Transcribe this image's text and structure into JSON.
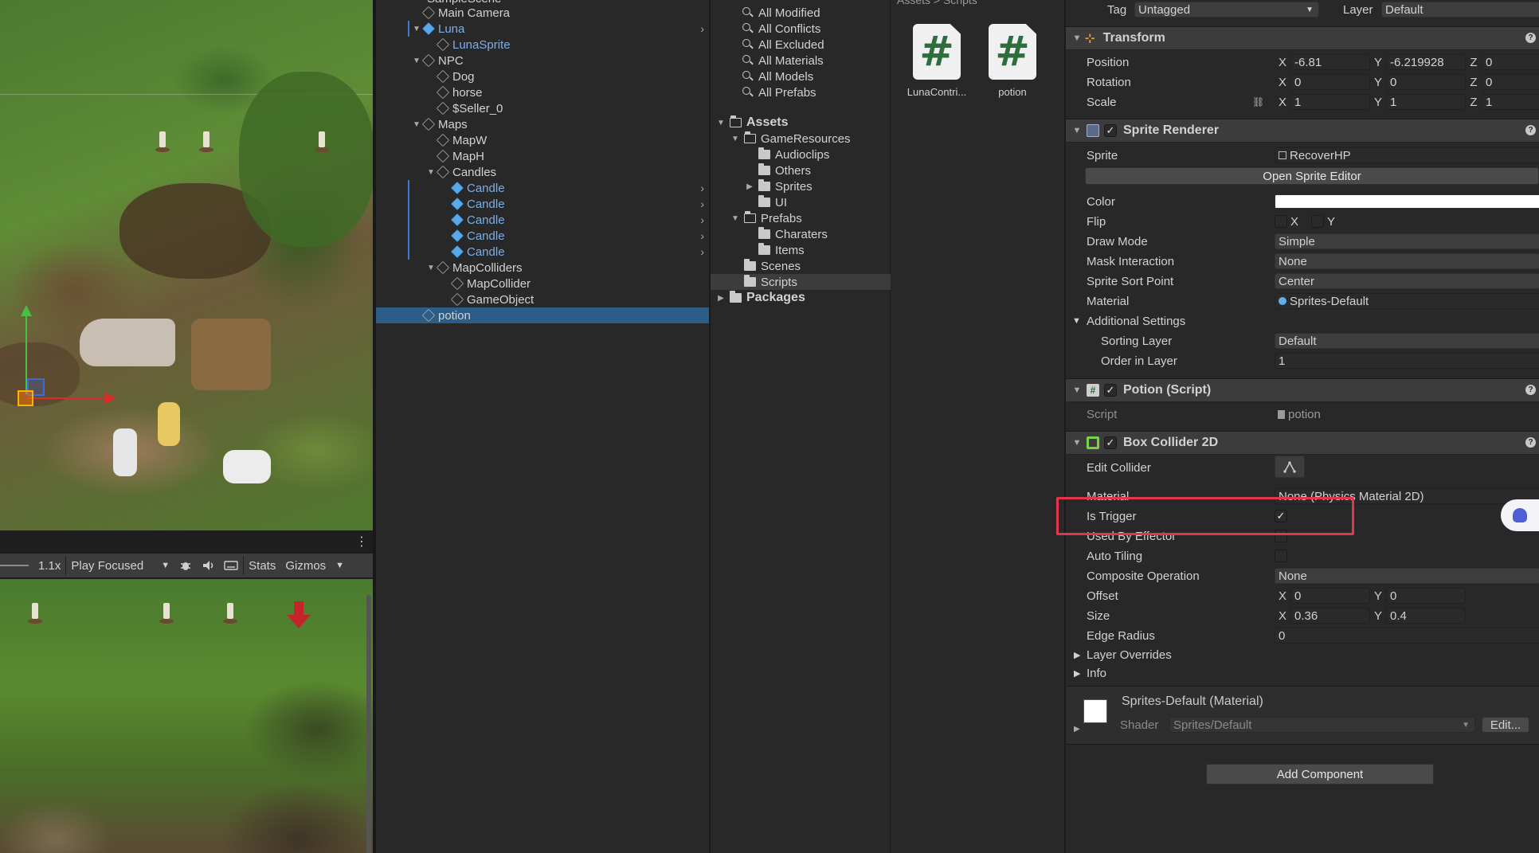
{
  "game_toolbar": {
    "scale": "1.1x",
    "play_mode": "Play Focused",
    "stats": "Stats",
    "gizmos": "Gizmos"
  },
  "hierarchy": {
    "top_cut": "SampleScene",
    "items": [
      {
        "label": "Main Camera",
        "depth": 2,
        "fold": "",
        "icon": "cube",
        "prefab": false,
        "selected": false,
        "chevron": false
      },
      {
        "label": "Luna",
        "depth": 2,
        "fold": "▼",
        "icon": "prefab",
        "prefab": true,
        "selected": false,
        "chevron": true
      },
      {
        "label": "LunaSprite",
        "depth": 3,
        "fold": "",
        "icon": "cube",
        "prefab": true,
        "selected": false,
        "chevron": false
      },
      {
        "label": "NPC",
        "depth": 2,
        "fold": "▼",
        "icon": "cube",
        "prefab": false,
        "selected": false,
        "chevron": false
      },
      {
        "label": "Dog",
        "depth": 3,
        "fold": "",
        "icon": "cube",
        "prefab": false,
        "selected": false,
        "chevron": false
      },
      {
        "label": "horse",
        "depth": 3,
        "fold": "",
        "icon": "cube",
        "prefab": false,
        "selected": false,
        "chevron": false
      },
      {
        "label": "$Seller_0",
        "depth": 3,
        "fold": "",
        "icon": "cube",
        "prefab": false,
        "selected": false,
        "chevron": false
      },
      {
        "label": "Maps",
        "depth": 2,
        "fold": "▼",
        "icon": "cube",
        "prefab": false,
        "selected": false,
        "chevron": false
      },
      {
        "label": "MapW",
        "depth": 3,
        "fold": "",
        "icon": "cube",
        "prefab": false,
        "selected": false,
        "chevron": false
      },
      {
        "label": "MapH",
        "depth": 3,
        "fold": "",
        "icon": "cube",
        "prefab": false,
        "selected": false,
        "chevron": false
      },
      {
        "label": "Candles",
        "depth": 3,
        "fold": "▼",
        "icon": "cube",
        "prefab": false,
        "selected": false,
        "chevron": false
      },
      {
        "label": "Candle",
        "depth": 4,
        "fold": "",
        "icon": "prefab",
        "prefab": true,
        "selected": false,
        "chevron": true
      },
      {
        "label": "Candle",
        "depth": 4,
        "fold": "",
        "icon": "prefab",
        "prefab": true,
        "selected": false,
        "chevron": true
      },
      {
        "label": "Candle",
        "depth": 4,
        "fold": "",
        "icon": "prefab",
        "prefab": true,
        "selected": false,
        "chevron": true
      },
      {
        "label": "Candle",
        "depth": 4,
        "fold": "",
        "icon": "prefab",
        "prefab": true,
        "selected": false,
        "chevron": true
      },
      {
        "label": "Candle",
        "depth": 4,
        "fold": "",
        "icon": "prefab",
        "prefab": true,
        "selected": false,
        "chevron": true
      },
      {
        "label": "MapColliders",
        "depth": 3,
        "fold": "▼",
        "icon": "cube",
        "prefab": false,
        "selected": false,
        "chevron": false
      },
      {
        "label": "MapCollider",
        "depth": 4,
        "fold": "",
        "icon": "cube",
        "prefab": false,
        "selected": false,
        "chevron": false
      },
      {
        "label": "GameObject",
        "depth": 4,
        "fold": "",
        "icon": "cube",
        "prefab": false,
        "selected": false,
        "chevron": false
      },
      {
        "label": "potion",
        "depth": 2,
        "fold": "",
        "icon": "cube",
        "prefab": false,
        "selected": true,
        "chevron": false
      }
    ]
  },
  "project": {
    "favorites": [
      "All Modified",
      "All Conflicts",
      "All Excluded",
      "All Materials",
      "All Models",
      "All Prefabs"
    ],
    "tree": [
      {
        "label": "Assets",
        "depth": 0,
        "fold": "▼",
        "open": true,
        "bold": true,
        "selected": false
      },
      {
        "label": "GameResources",
        "depth": 1,
        "fold": "▼",
        "open": true,
        "bold": false,
        "selected": false
      },
      {
        "label": "Audioclips",
        "depth": 2,
        "fold": "",
        "open": false,
        "bold": false,
        "selected": false
      },
      {
        "label": "Others",
        "depth": 2,
        "fold": "",
        "open": false,
        "bold": false,
        "selected": false
      },
      {
        "label": "Sprites",
        "depth": 2,
        "fold": "▶",
        "open": false,
        "bold": false,
        "selected": false
      },
      {
        "label": "UI",
        "depth": 2,
        "fold": "",
        "open": false,
        "bold": false,
        "selected": false
      },
      {
        "label": "Prefabs",
        "depth": 1,
        "fold": "▼",
        "open": true,
        "bold": false,
        "selected": false
      },
      {
        "label": "Charaters",
        "depth": 2,
        "fold": "",
        "open": false,
        "bold": false,
        "selected": false
      },
      {
        "label": "Items",
        "depth": 2,
        "fold": "",
        "open": false,
        "bold": false,
        "selected": false
      },
      {
        "label": "Scenes",
        "depth": 1,
        "fold": "",
        "open": false,
        "bold": false,
        "selected": false
      },
      {
        "label": "Scripts",
        "depth": 1,
        "fold": "",
        "open": false,
        "bold": false,
        "selected": true
      },
      {
        "label": "Packages",
        "depth": 0,
        "fold": "▶",
        "open": false,
        "bold": true,
        "selected": false
      }
    ],
    "breadcrumb": "Assets > Scripts",
    "assets": [
      {
        "name": "LunaContri...",
        "glyph": "#"
      },
      {
        "name": "potion",
        "glyph": "#"
      }
    ]
  },
  "inspector": {
    "tag_label": "Tag",
    "tag_value": "Untagged",
    "layer_label": "Layer",
    "layer_value": "Default",
    "transform": {
      "title": "Transform",
      "position": {
        "label": "Position",
        "x": "-6.81",
        "y": "-6.219928",
        "z": "0"
      },
      "rotation": {
        "label": "Rotation",
        "x": "0",
        "y": "0",
        "z": "0"
      },
      "scale": {
        "label": "Scale",
        "x": "1",
        "y": "1",
        "z": "1"
      }
    },
    "sprite_renderer": {
      "title": "Sprite Renderer",
      "sprite_label": "Sprite",
      "sprite_value": "RecoverHP",
      "open_editor": "Open Sprite Editor",
      "color_label": "Color",
      "color_value": "#ffffff",
      "flip_label": "Flip",
      "flip_x": "X",
      "flip_y": "Y",
      "draw_mode_label": "Draw Mode",
      "draw_mode": "Simple",
      "mask_label": "Mask Interaction",
      "mask": "None",
      "sort_point_label": "Sprite Sort Point",
      "sort_point": "Center",
      "material_label": "Material",
      "material": "Sprites-Default",
      "additional": "Additional Settings",
      "sorting_layer_label": "Sorting Layer",
      "sorting_layer": "Default",
      "order_label": "Order in Layer",
      "order": "1"
    },
    "potion_script": {
      "title": "Potion (Script)",
      "script_label": "Script",
      "script_value": "potion"
    },
    "box_collider": {
      "title": "Box Collider 2D",
      "edit_label": "Edit Collider",
      "material_label": "Material",
      "material_value": "None (Physics Material 2D)",
      "is_trigger_label": "Is Trigger",
      "is_trigger": true,
      "used_by_effector_label": "Used By Effector",
      "auto_tiling_label": "Auto Tiling",
      "composite_label": "Composite Operation",
      "composite": "None",
      "offset_label": "Offset",
      "offset_x": "0",
      "offset_y": "0",
      "size_label": "Size",
      "size_x": "0.36",
      "size_y": "0.4",
      "edge_label": "Edge Radius",
      "edge": "0",
      "layer_overrides": "Layer Overrides",
      "info": "Info"
    },
    "material_asset": {
      "name": "Sprites-Default (Material)",
      "shader_label": "Shader",
      "shader": "Sprites/Default",
      "edit": "Edit..."
    },
    "add_component": "Add Component"
  },
  "colors": {
    "selection": "#2c5d87",
    "prefab_text": "#7bafe8",
    "highlight_box": "#e3364c"
  }
}
